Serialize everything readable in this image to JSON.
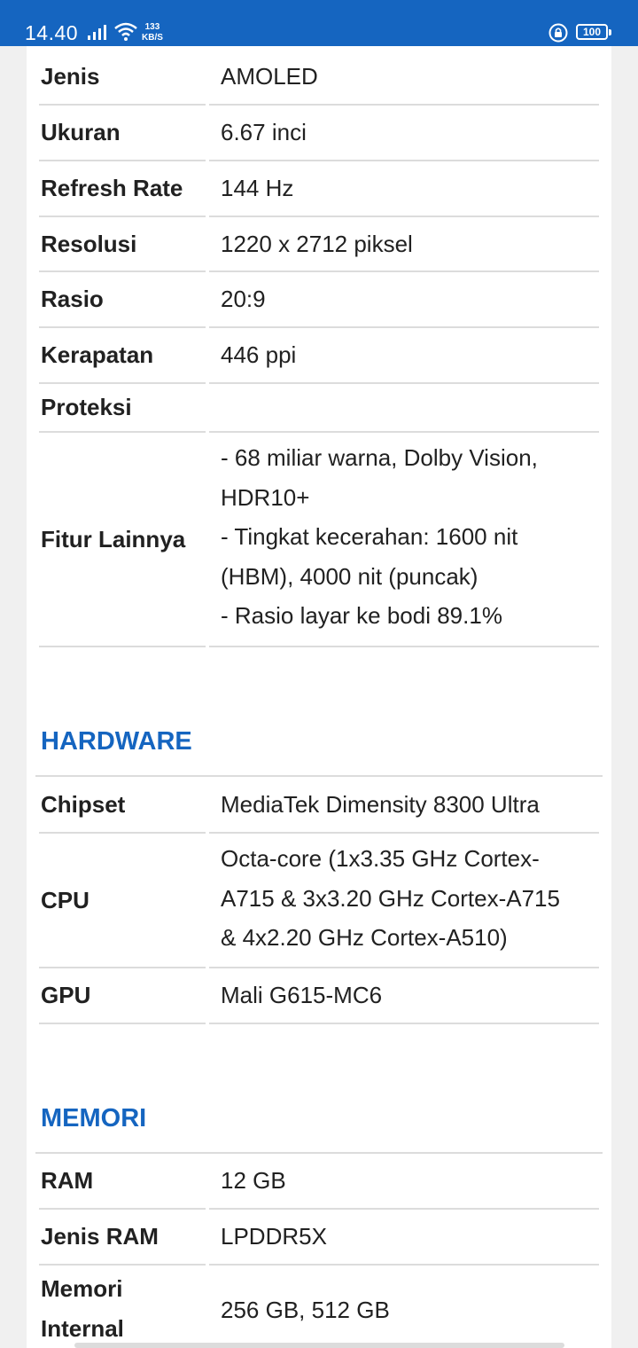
{
  "status_bar": {
    "time": "14.40",
    "network_speed_value": "133",
    "network_speed_unit": "KB/S",
    "battery": "100",
    "signal_icon": "signal-bars-icon",
    "wifi_icon": "wifi-icon",
    "lock_icon": "rotation-lock-icon",
    "bg_color": "#1565c0"
  },
  "colors": {
    "section_title": "#1565c0",
    "text": "#212121",
    "divider": "#dcdcdc"
  },
  "layar": {
    "rows": [
      {
        "label": "Jenis",
        "value": "AMOLED"
      },
      {
        "label": "Ukuran",
        "value": "6.67 inci"
      },
      {
        "label": "Refresh Rate",
        "value": "144 Hz"
      },
      {
        "label": "Resolusi",
        "value": "1220 x 2712 piksel"
      },
      {
        "label": "Rasio",
        "value": "20:9"
      },
      {
        "label": "Kerapatan",
        "value": "446 ppi"
      },
      {
        "label": "Proteksi",
        "value": ""
      },
      {
        "label": "Fitur Lainnya",
        "lines": [
          "- 68 miliar warna, Dolby Vision,",
          "HDR10+",
          "- Tingkat kecerahan: 1600 nit",
          "(HBM), 4000 nit (puncak)",
          "- Rasio layar ke bodi 89.1%"
        ]
      }
    ]
  },
  "hardware": {
    "title": "HARDWARE",
    "rows": [
      {
        "label": "Chipset",
        "value": "MediaTek Dimensity 8300 Ultra"
      },
      {
        "label": "CPU",
        "lines": [
          "Octa-core (1x3.35 GHz Cortex-",
          "A715 & 3x3.20 GHz Cortex-A715",
          "& 4x2.20 GHz Cortex-A510)"
        ]
      },
      {
        "label": "GPU",
        "value": "Mali G615-MC6"
      }
    ]
  },
  "memori": {
    "title": "MEMORI",
    "rows": [
      {
        "label": "RAM",
        "value": "12 GB"
      },
      {
        "label": "Jenis RAM",
        "value": "LPDDR5X"
      },
      {
        "label_lines": [
          "Memori",
          "Internal"
        ],
        "value": "256 GB, 512 GB"
      }
    ]
  }
}
